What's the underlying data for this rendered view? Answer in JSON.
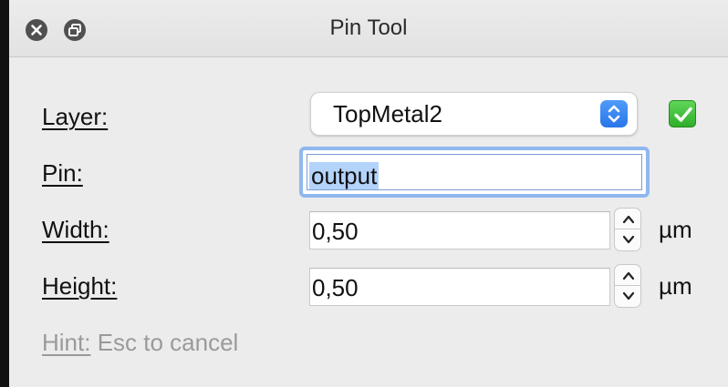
{
  "window": {
    "title": "Pin Tool",
    "buttons": [
      "close-icon",
      "restore-icon"
    ]
  },
  "form": {
    "layer": {
      "label": "Layer:",
      "value": "TopMetal2",
      "confirm_icon": "checkmark-icon"
    },
    "pin": {
      "label": "Pin:",
      "value": "output",
      "selected": true
    },
    "width": {
      "label": "Width:",
      "value": "0,50",
      "unit": "µm"
    },
    "height": {
      "label": "Height:",
      "value": "0,50",
      "unit": "µm"
    }
  },
  "hint": {
    "label": "Hint:",
    "text": " Esc to cancel"
  },
  "colors": {
    "accent": "#2a75ea",
    "selection": "#b4d3fb",
    "focus_ring": "#8fb8ef",
    "checkmark": "#2fae2a"
  }
}
